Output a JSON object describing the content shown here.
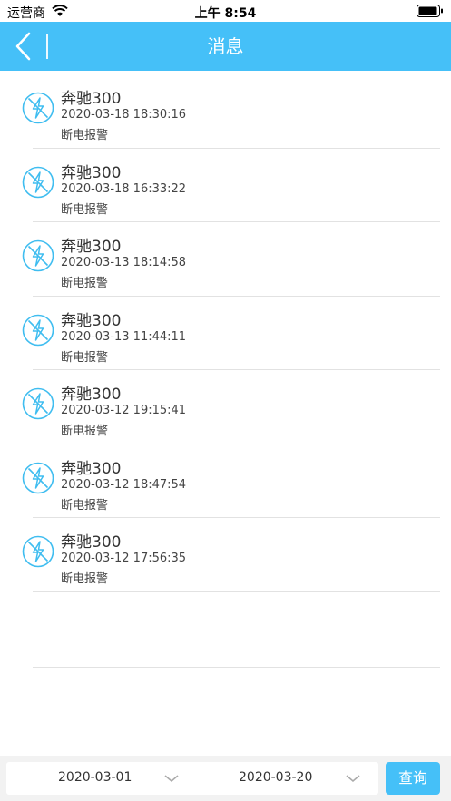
{
  "status_bar": {
    "carrier": "运营商",
    "time": "上午 8:54"
  },
  "nav": {
    "title": "消息",
    "back_icon": "chevron-left-icon"
  },
  "colors": {
    "accent": "#45c0f8",
    "separator": "#e2e2e2"
  },
  "messages": [
    {
      "title": "奔驰300",
      "time": "2020-03-18 18:30:16",
      "type": "断电报警",
      "icon": "power-off-icon"
    },
    {
      "title": "奔驰300",
      "time": "2020-03-18 16:33:22",
      "type": "断电报警",
      "icon": "power-off-icon"
    },
    {
      "title": "奔驰300",
      "time": "2020-03-13 18:14:58",
      "type": "断电报警",
      "icon": "power-off-icon"
    },
    {
      "title": "奔驰300",
      "time": "2020-03-13 11:44:11",
      "type": "断电报警",
      "icon": "power-off-icon"
    },
    {
      "title": "奔驰300",
      "time": "2020-03-12 19:15:41",
      "type": "断电报警",
      "icon": "power-off-icon"
    },
    {
      "title": "奔驰300",
      "time": "2020-03-12 18:47:54",
      "type": "断电报警",
      "icon": "power-off-icon"
    },
    {
      "title": "奔驰300",
      "time": "2020-03-12 17:56:35",
      "type": "断电报警",
      "icon": "power-off-icon"
    }
  ],
  "filter": {
    "start_date": "2020-03-01",
    "end_date": "2020-03-20",
    "query_label": "查询"
  }
}
